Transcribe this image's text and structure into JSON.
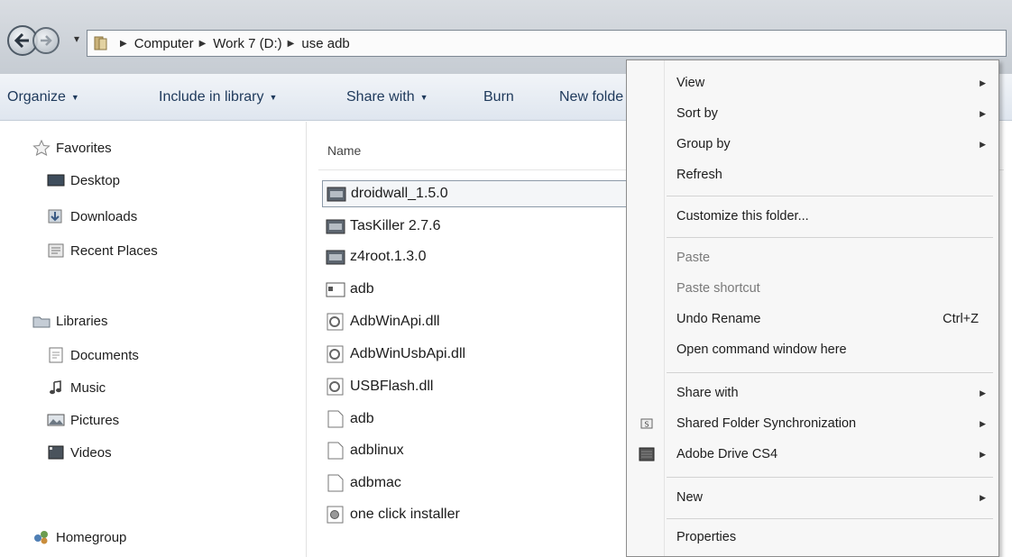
{
  "address": {
    "crumbs": [
      "Computer",
      "Work 7 (D:)",
      "use adb"
    ]
  },
  "toolbar": {
    "organize": "Organize",
    "include": "Include in library",
    "share": "Share with",
    "burn": "Burn",
    "new_folder": "New folde"
  },
  "nav": {
    "favorites": "Favorites",
    "desktop": "Desktop",
    "downloads": "Downloads",
    "recent": "Recent Places",
    "libraries": "Libraries",
    "documents": "Documents",
    "music": "Music",
    "pictures": "Pictures",
    "videos": "Videos",
    "homegroup": "Homegroup"
  },
  "files": {
    "column_name": "Name",
    "items": [
      "droidwall_1.5.0",
      "TasKiller 2.7.6",
      "z4root.1.3.0",
      "adb",
      "AdbWinApi.dll",
      "AdbWinUsbApi.dll",
      "USBFlash.dll",
      "adb",
      "adblinux",
      "adbmac",
      "one click installer"
    ]
  },
  "menu": {
    "view": "View",
    "sort_by": "Sort by",
    "group_by": "Group by",
    "refresh": "Refresh",
    "customize": "Customize this folder...",
    "paste": "Paste",
    "paste_shortcut": "Paste shortcut",
    "undo_rename": "Undo Rename",
    "undo_shortcut": "Ctrl+Z",
    "open_cmd": "Open command window here",
    "share_with": "Share with",
    "shared_sync": "Shared Folder Synchronization",
    "adobe_drive": "Adobe Drive CS4",
    "new": "New",
    "properties": "Properties"
  }
}
